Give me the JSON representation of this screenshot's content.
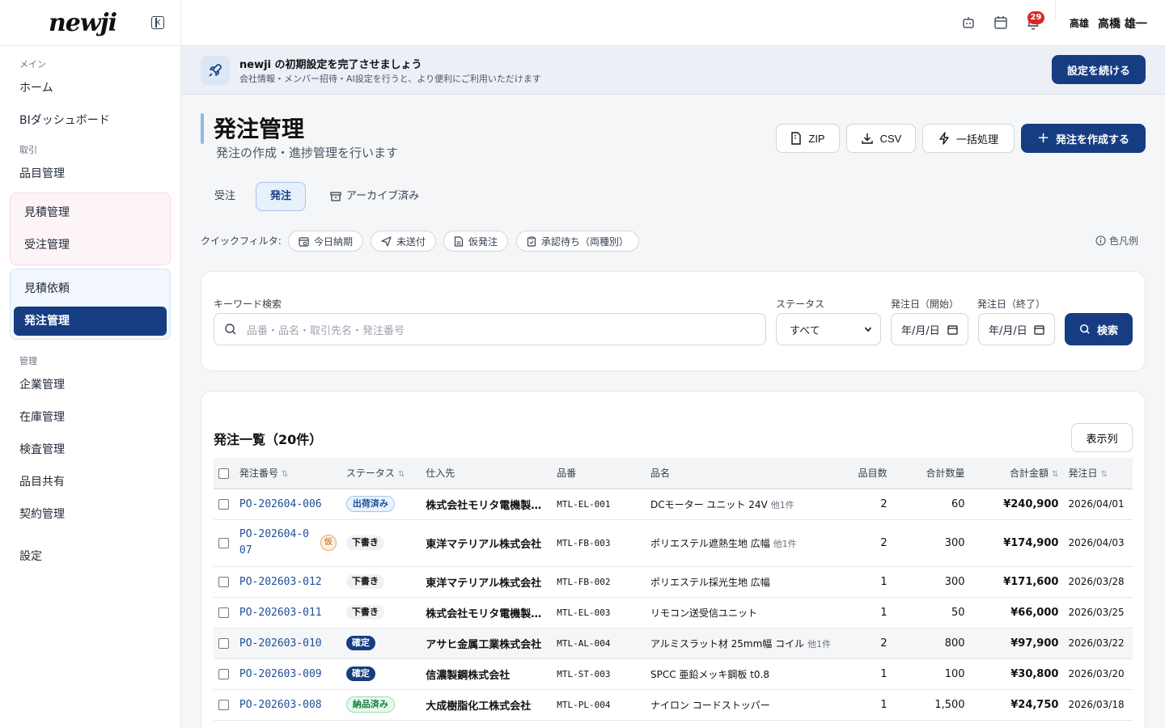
{
  "app": {
    "logo": "newji"
  },
  "sidebar": {
    "sections": {
      "main": "メイン",
      "trade": "取引",
      "manage": "管理"
    },
    "main_items": [
      "ホーム",
      "BIダッシュボード"
    ],
    "trade_items": [
      "品目管理"
    ],
    "sales_group": [
      "見積管理",
      "受注管理"
    ],
    "purchase_group": [
      "見積依頼",
      "発注管理"
    ],
    "manage_items": [
      "企業管理",
      "在庫管理",
      "検査管理",
      "品目共有",
      "契約管理"
    ],
    "settings": "設定"
  },
  "topbar": {
    "notification_count": "29",
    "user_org": "高雄",
    "user_name": "高橋 雄一"
  },
  "banner": {
    "title": "newji の初期設定を完了させましょう",
    "subtitle": "会社情報・メンバー招待・AI設定を行うと、より便利にご利用いただけます",
    "button": "設定を続ける"
  },
  "page": {
    "title": "発注管理",
    "subtitle": "発注の作成・進捗管理を行います",
    "actions": {
      "zip": "ZIP",
      "csv": "CSV",
      "bulk": "一括処理",
      "create": "発注を作成する"
    }
  },
  "tabs": [
    "受注",
    "発注",
    "アーカイブ済み"
  ],
  "quick_filter": {
    "label": "クイックフィルタ:",
    "chips": [
      "今日納期",
      "未送付",
      "仮発注",
      "承認待ち（両種別）"
    ],
    "legend": "色凡例"
  },
  "search": {
    "keyword_label": "キーワード検索",
    "keyword_placeholder": "品番・品名・取引先名・発注番号",
    "status_label": "ステータス",
    "status_value": "すべて",
    "date_start_label": "発注日（開始）",
    "date_end_label": "発注日（終了）",
    "date_placeholder": "年/月/日",
    "button": "検索"
  },
  "table": {
    "title": "発注一覧（20件）",
    "columns_button": "表示列",
    "headers": {
      "po": "発注番号",
      "status": "ステータス",
      "supplier": "仕入先",
      "part_no": "品番",
      "item": "品名",
      "lines": "品目数",
      "qty": "合計数量",
      "amount": "合計金額",
      "date": "発注日"
    },
    "rows": [
      {
        "po": "PO-202604-006",
        "status": "出荷済み",
        "status_type": "ship",
        "supplier": "株式会社モリタ電機製作所",
        "part": "MTL-EL-001",
        "item": "DCモーター ユニット 24V",
        "more": "他1件",
        "lines": "2",
        "qty": "60",
        "amount": "¥240,900",
        "date": "2026/04/01"
      },
      {
        "po": "PO-202604-007",
        "provisional": "仮",
        "status": "下書き",
        "status_type": "draft",
        "supplier": "東洋マテリアル株式会社",
        "part": "MTL-FB-003",
        "item": "ポリエステル遮熱生地 広幅",
        "more": "他1件",
        "lines": "2",
        "qty": "300",
        "amount": "¥174,900",
        "date": "2026/04/03"
      },
      {
        "po": "PO-202603-012",
        "status": "下書き",
        "status_type": "draft",
        "supplier": "東洋マテリアル株式会社",
        "part": "MTL-FB-002",
        "item": "ポリエステル採光生地 広幅",
        "more": "",
        "lines": "1",
        "qty": "300",
        "amount": "¥171,600",
        "date": "2026/03/28"
      },
      {
        "po": "PO-202603-011",
        "status": "下書き",
        "status_type": "draft",
        "supplier": "株式会社モリタ電機製作所",
        "part": "MTL-EL-003",
        "item": "リモコン送受信ユニット",
        "more": "",
        "lines": "1",
        "qty": "50",
        "amount": "¥66,000",
        "date": "2026/03/25"
      },
      {
        "po": "PO-202603-010",
        "status": "確定",
        "status_type": "conf",
        "supplier": "アサヒ金属工業株式会社",
        "part": "MTL-AL-004",
        "item": "アルミスラット材 25mm幅 コイル",
        "more": "他1件",
        "lines": "2",
        "qty": "800",
        "amount": "¥97,900",
        "date": "2026/03/22"
      },
      {
        "po": "PO-202603-009",
        "status": "確定",
        "status_type": "conf",
        "supplier": "信濃製鋼株式会社",
        "part": "MTL-ST-003",
        "item": "SPCC 亜鉛メッキ鋼板 t0.8",
        "more": "",
        "lines": "1",
        "qty": "100",
        "amount": "¥30,800",
        "date": "2026/03/20"
      },
      {
        "po": "PO-202603-008",
        "status": "納品済み",
        "status_type": "recv",
        "supplier": "大成樹脂化工株式会社",
        "part": "MTL-PL-004",
        "item": "ナイロン コードストッパー",
        "more": "",
        "lines": "1",
        "qty": "1,500",
        "amount": "¥24,750",
        "date": "2026/03/18"
      }
    ]
  }
}
